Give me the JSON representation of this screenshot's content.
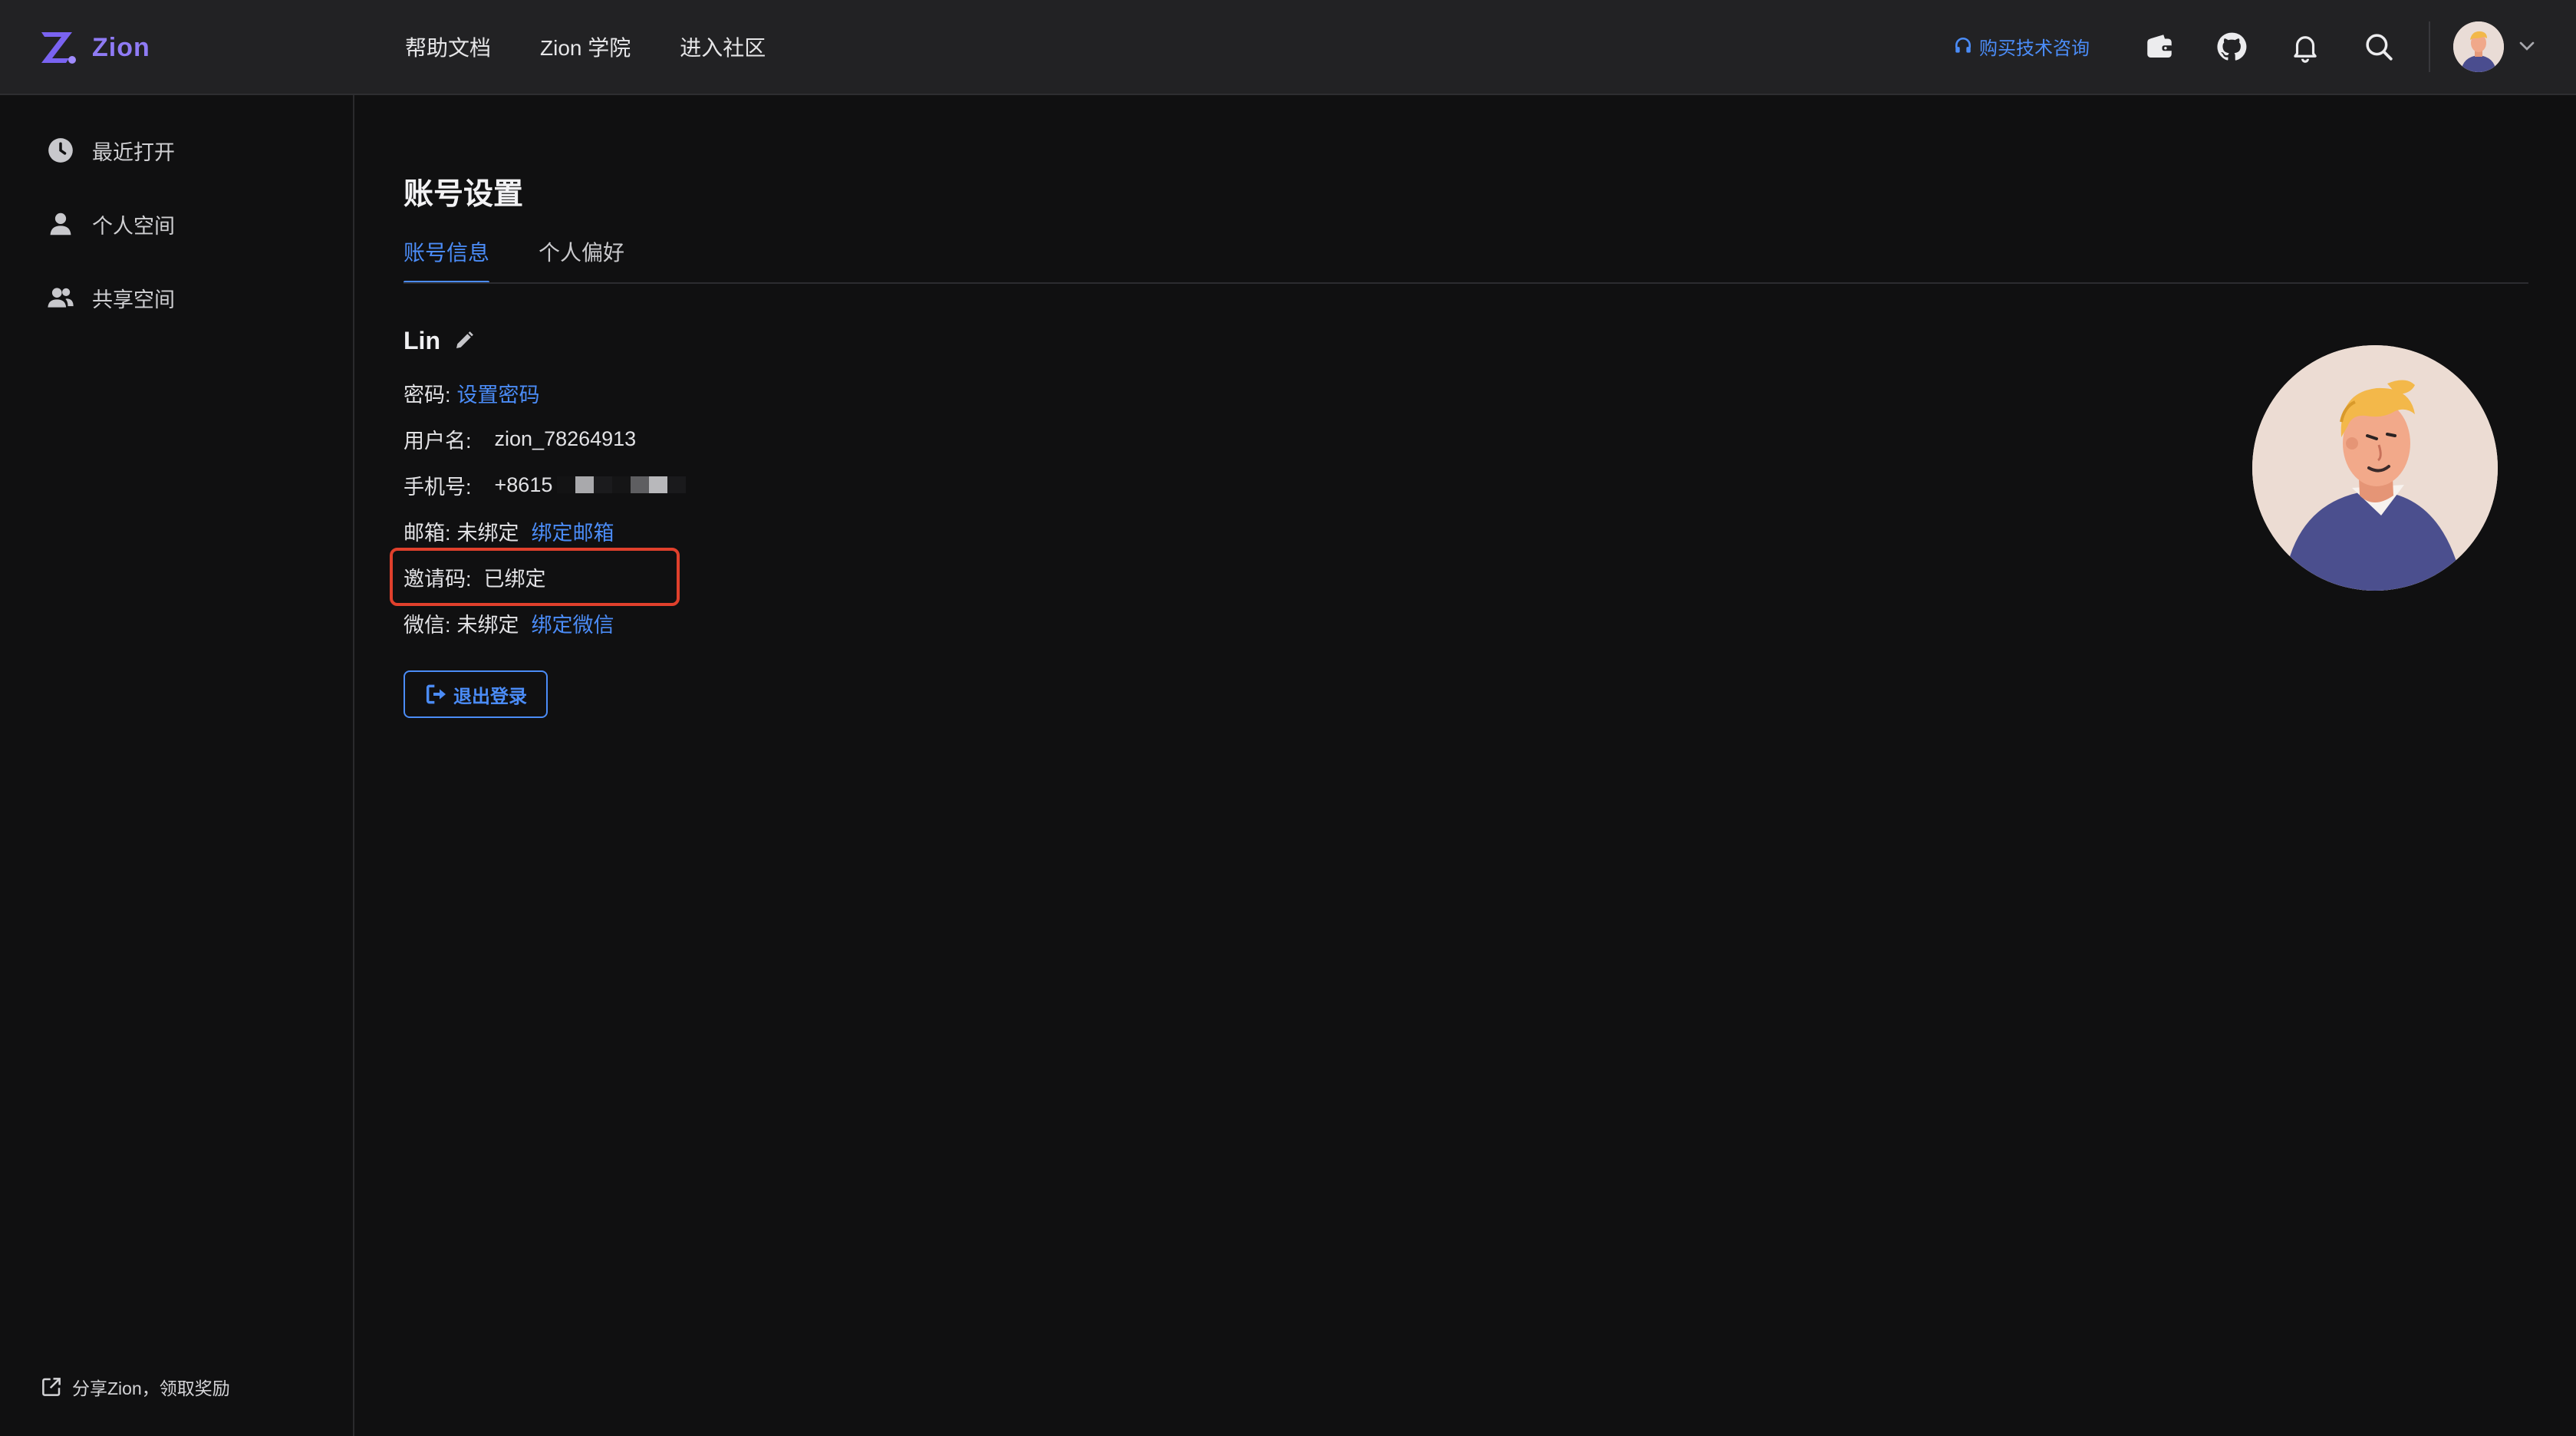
{
  "header": {
    "logo_text": "Zion",
    "nav": [
      "帮助文档",
      "Zion 学院",
      "进入社区"
    ],
    "consult_label": "购买技术咨询",
    "icons": [
      "wallet-icon",
      "github-icon",
      "bell-icon",
      "search-icon",
      "chevron-down-icon"
    ]
  },
  "sidebar": {
    "items": [
      {
        "label": "最近打开",
        "icon": "clock-icon"
      },
      {
        "label": "个人空间",
        "icon": "person-icon"
      },
      {
        "label": "共享空间",
        "icon": "people-icon"
      }
    ],
    "share_label": "分享Zion，领取奖励"
  },
  "main": {
    "title": "账号设置",
    "tabs": [
      {
        "label": "账号信息",
        "active": true
      },
      {
        "label": "个人偏好",
        "active": false
      }
    ],
    "account": {
      "name": "Lin",
      "password_label": "密码:",
      "password_link": "设置密码",
      "username_label": "用户名:",
      "username_value": "zion_78264913",
      "phone_label": "手机号:",
      "phone_value": "+8615",
      "email_label": "邮箱:",
      "email_value": "未绑定",
      "email_link": "绑定邮箱",
      "invite_label": "邀请码:",
      "invite_value": "已绑定",
      "wechat_label": "微信:",
      "wechat_value": "未绑定",
      "wechat_link": "绑定微信"
    },
    "logout_label": "退出登录"
  },
  "colors": {
    "accent": "#4b8cf7",
    "logo": "#8f7bf5",
    "highlight": "#e0402c",
    "background": "#101011",
    "topbar": "#222224"
  }
}
